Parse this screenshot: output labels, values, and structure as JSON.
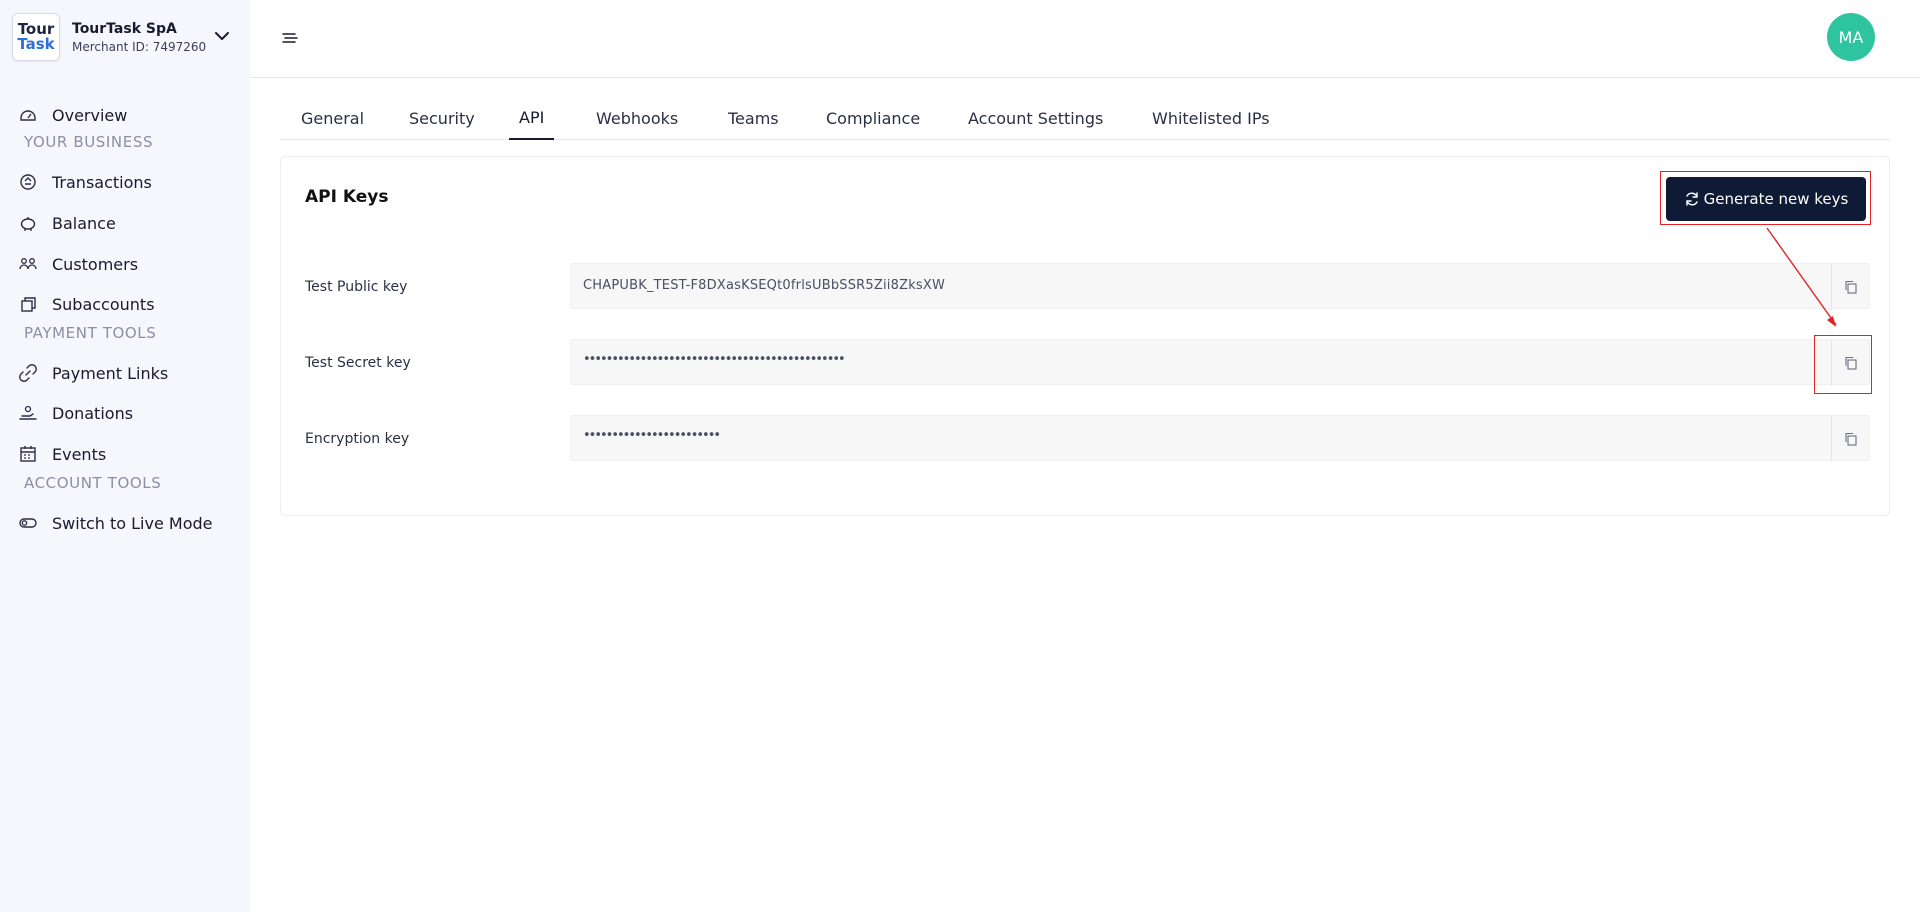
{
  "merchant": {
    "logo_line1": "Tour",
    "logo_line2": "Task",
    "name": "TourTask SpA",
    "id_text": "Merchant ID: 7497260"
  },
  "sidebar": {
    "items": [
      {
        "label": "Overview",
        "icon": "dashboard-icon"
      },
      {
        "section": "YOUR BUSINESS"
      },
      {
        "label": "Transactions",
        "icon": "transactions-icon"
      },
      {
        "label": "Balance",
        "icon": "piggy-bank-icon"
      },
      {
        "label": "Customers",
        "icon": "users-icon"
      },
      {
        "label": "Subaccounts",
        "icon": "stack-icon"
      },
      {
        "section": "PAYMENT TOOLS"
      },
      {
        "label": "Payment Links",
        "icon": "link-icon"
      },
      {
        "label": "Donations",
        "icon": "donation-icon"
      },
      {
        "label": "Events",
        "icon": "calendar-icon"
      },
      {
        "section": "ACCOUNT TOOLS"
      },
      {
        "label": "Switch to Live Mode",
        "icon": "toggle-icon"
      }
    ]
  },
  "header": {
    "avatar_initials": "MA",
    "avatar_color": "#2ec4a0"
  },
  "tabs": [
    {
      "label": "General"
    },
    {
      "label": "Security"
    },
    {
      "label": "API",
      "active": true
    },
    {
      "label": "Webhooks"
    },
    {
      "label": "Teams"
    },
    {
      "label": "Compliance"
    },
    {
      "label": "Account Settings"
    },
    {
      "label": "Whitelisted IPs"
    }
  ],
  "api_keys": {
    "title": "API Keys",
    "generate_label": "Generate new keys",
    "rows": [
      {
        "label": "Test Public key",
        "value": "CHAPUBK_TEST-F8DXasKSEQt0frlsUBbSSR5Zii8ZksXW"
      },
      {
        "label": "Test Secret key",
        "value": "••••••••••••••••••••••••••••••••••••••••••••••"
      },
      {
        "label": "Encryption key",
        "value": "••••••••••••••••••••••••"
      }
    ]
  },
  "colors": {
    "primary": "#0f1a35",
    "annotation": "#e02424",
    "sidebar_bg": "#f6f7fc"
  }
}
